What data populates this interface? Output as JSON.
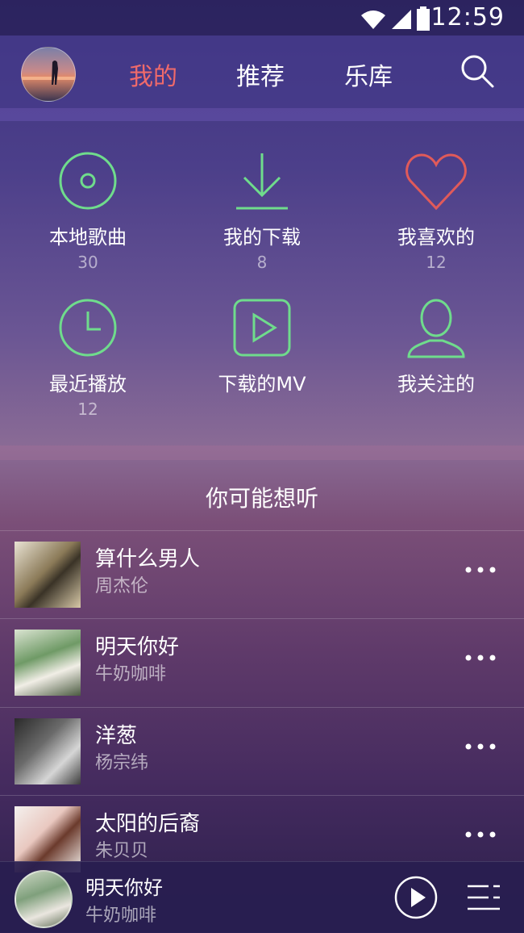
{
  "status": {
    "time": "12:59"
  },
  "nav": {
    "tabs": [
      {
        "label": "我的"
      },
      {
        "label": "推荐"
      },
      {
        "label": "乐库"
      }
    ]
  },
  "grid": {
    "items": [
      {
        "label": "本地歌曲",
        "count": "30",
        "icon": "disc-icon"
      },
      {
        "label": "我的下载",
        "count": "8",
        "icon": "download-icon"
      },
      {
        "label": "我喜欢的",
        "count": "12",
        "icon": "heart-icon"
      },
      {
        "label": "最近播放",
        "count": "12",
        "icon": "clock-icon"
      },
      {
        "label": "下载的MV",
        "count": "",
        "icon": "video-icon"
      },
      {
        "label": "我关注的",
        "count": "",
        "icon": "user-icon"
      }
    ]
  },
  "section": {
    "title": "你可能想听"
  },
  "songs": [
    {
      "title": "算什么男人",
      "artist": "周杰伦"
    },
    {
      "title": "明天你好",
      "artist": "牛奶咖啡"
    },
    {
      "title": "洋葱",
      "artist": "杨宗纬"
    },
    {
      "title": "太阳的后裔",
      "artist": "朱贝贝"
    }
  ],
  "player": {
    "title": "明天你好",
    "artist": "牛奶咖啡"
  },
  "colors": {
    "accent": "#f06a6a",
    "green": "#6fdc8c",
    "heart": "#e05a5a"
  }
}
